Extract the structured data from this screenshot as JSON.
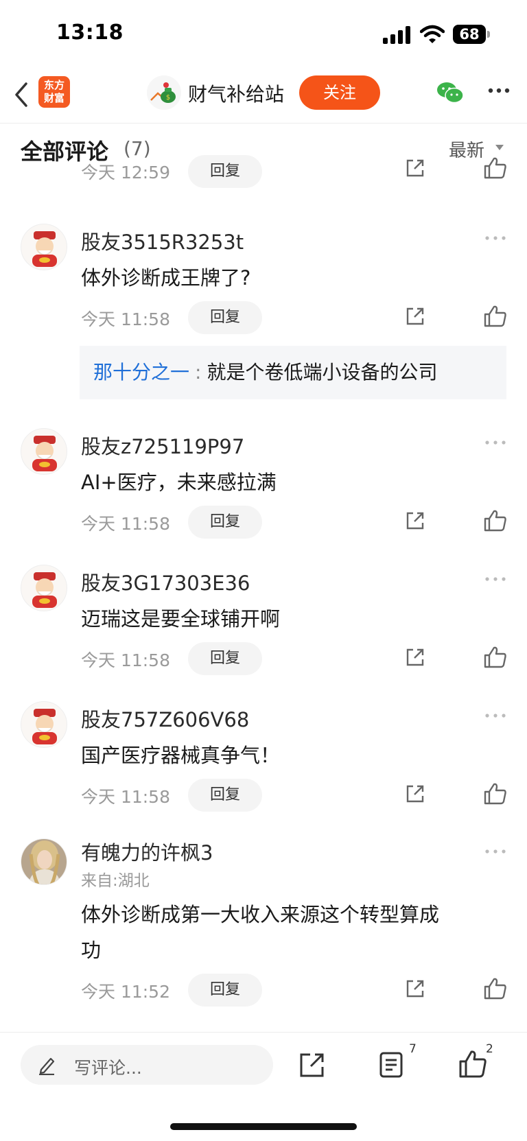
{
  "status_bar": {
    "time": "13:18",
    "battery": "68"
  },
  "nav": {
    "logo_line1": "东方",
    "logo_line2": "财富",
    "channel_name": "财气补给站",
    "follow_label": "关注"
  },
  "section": {
    "title": "全部评论",
    "count": "(7)",
    "sort": "最新"
  },
  "partial_comment": {
    "time": "今天 12:59",
    "reply": "回复"
  },
  "comments": [
    {
      "user": "股友3515R3253t",
      "text": "体外诊断成王牌了?",
      "time": "今天 11:58",
      "reply": "回复"
    },
    {
      "user": "股友z725119P97",
      "text": "AI+医疗，未来感拉满",
      "time": "今天 11:58",
      "reply": "回复"
    },
    {
      "user": "股友3G17303E36",
      "text": "迈瑞这是要全球铺开啊",
      "time": "今天 11:58",
      "reply": "回复"
    },
    {
      "user": "股友757Z606V68",
      "text": "国产医疗器械真争气！",
      "time": "今天 11:58",
      "reply": "回复"
    },
    {
      "user": "有魄力的许枫3",
      "location": "来自:湖北",
      "text_line1": "体外诊断成第一大收入来源这个转型算成",
      "text_line2": "功",
      "time": "今天 11:52",
      "reply": "回复"
    }
  ],
  "sub_reply": {
    "name": "那十分之一",
    "separator": ":",
    "text": "就是个卷低端小设备的公司"
  },
  "bottom_bar": {
    "write_placeholder": "写评论...",
    "comment_count": "7",
    "like_count": "2"
  },
  "colors": {
    "accent": "#f55418",
    "link": "#1f6fd8",
    "logo": "#f45a22"
  },
  "icons": [
    "back-icon",
    "wechat-icon",
    "more-icon",
    "share-icon",
    "like-icon",
    "pen-icon",
    "comments-list-icon"
  ]
}
